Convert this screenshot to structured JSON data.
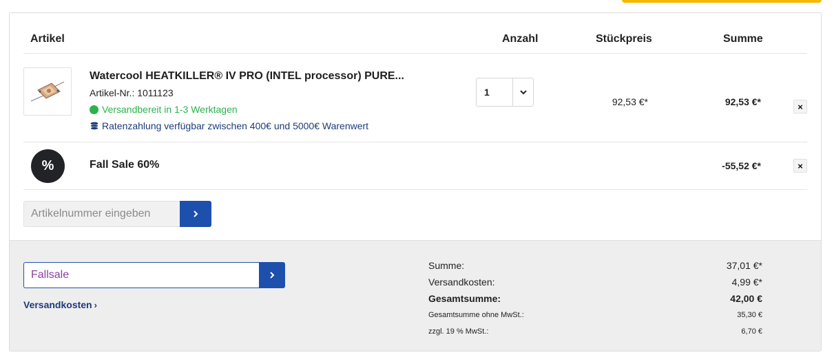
{
  "header": {
    "artikel": "Artikel",
    "anzahl": "Anzahl",
    "stueckpreis": "Stückpreis",
    "summe": "Summe"
  },
  "item": {
    "title": "Watercool HEATKILLER® IV PRO (INTEL processor) PURE...",
    "artnr": "Artikel-Nr.: 1011123",
    "shipping_status": "Versandbereit in 1-3 Werktagen",
    "financing": "Ratenzahlung verfügbar zwischen 400€ und 5000€ Warenwert",
    "quantity": "1",
    "unit_price": "92,53 €*",
    "total": "92,53 €*",
    "remove_label": "×"
  },
  "discount": {
    "badge": "%",
    "label": "Fall Sale 60%",
    "amount": "-55,52 €*",
    "remove_label": "×"
  },
  "article_input": {
    "placeholder": "Artikelnummer eingeben"
  },
  "voucher": {
    "value": "Fallsale"
  },
  "shipping_link": "Versandkosten",
  "totals": {
    "rows": [
      {
        "label": "Summe:",
        "value": "37,01 €*"
      },
      {
        "label": "Versandkosten:",
        "value": "4,99 €*"
      },
      {
        "label": "Gesamtsumme:",
        "value": "42,00 €"
      },
      {
        "label": "Gesamtsumme ohne MwSt.:",
        "value": "35,30 €"
      },
      {
        "label": "zzgl. 19 % MwSt.:",
        "value": "6,70 €"
      }
    ]
  },
  "colors": {
    "accent_yellow": "#f6b800",
    "primary_blue": "#1d4fad",
    "success_green": "#2bb24c",
    "link_navy": "#1d3a7a"
  },
  "icons": [
    "product-thumbnail",
    "check-dot-icon",
    "coins-icon",
    "chevron-down-icon",
    "close-icon",
    "percent-icon",
    "chevron-right-icon"
  ]
}
